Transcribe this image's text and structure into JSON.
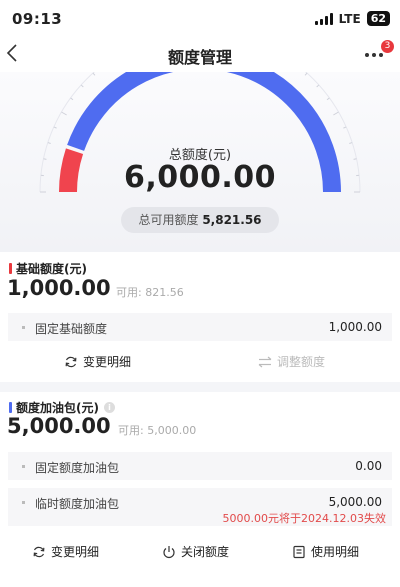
{
  "status": {
    "time": "09:13",
    "network": "LTE",
    "battery": "62"
  },
  "nav": {
    "title": "额度管理",
    "badge": "3"
  },
  "gauge": {
    "label": "总额度(元)",
    "amount": "6,000.00",
    "available_label": "总可用额度",
    "available": "5,821.56",
    "used_fraction": 0.1,
    "color_used": "#f0444e",
    "color_available": "#4f6cf0"
  },
  "base": {
    "title": "基础额度(元)",
    "amount": "1,000.00",
    "available": "可用: 821.56",
    "rows": [
      {
        "label": "固定基础额度",
        "value": "1,000.00"
      }
    ],
    "actions": {
      "detail": "变更明细",
      "adjust": "调整额度"
    },
    "accent": "#e8383d"
  },
  "boost": {
    "title": "额度加油包(元)",
    "info": "i",
    "amount": "5,000.00",
    "available": "可用: 5,000.00",
    "rows": [
      {
        "label": "固定额度加油包",
        "value": "0.00"
      },
      {
        "label": "临时额度加油包",
        "value": "5,000.00"
      }
    ],
    "note": "5000.00元将于2024.12.03失效",
    "actions": {
      "detail": "变更明细",
      "close": "关闭额度",
      "usage": "使用明细"
    },
    "accent": "#4f6cf0"
  }
}
